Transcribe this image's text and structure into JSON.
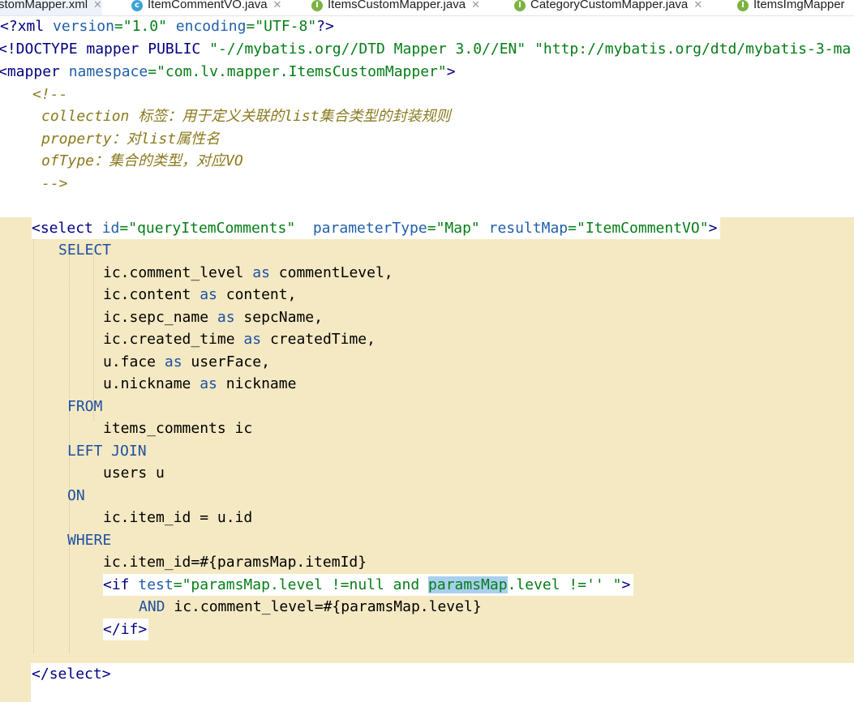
{
  "tabs": [
    {
      "label": "stomMapper.xml",
      "icon": "xml-file-icon",
      "active": true
    },
    {
      "label": "ItemCommentVO.java",
      "icon": "class-icon"
    },
    {
      "label": "ItemsCustomMapper.java",
      "icon": "interface-icon"
    },
    {
      "label": "CategoryCustomMapper.java",
      "icon": "interface-icon"
    },
    {
      "label": "ItemsImgMapper",
      "icon": "interface-icon"
    }
  ],
  "code": {
    "xml_decl": [
      "<?",
      "xml ",
      "version",
      "=\"1.0\" ",
      "encoding",
      "=\"UTF-8\"",
      "?>"
    ],
    "doctype": [
      "<!DOCTYPE ",
      "mapper ",
      "PUBLIC ",
      "\"-//mybatis.org//DTD Mapper 3.0//EN\" ",
      "\"http://mybatis.org/dtd/mybatis-3-ma"
    ],
    "mapper_open": [
      "<",
      "mapper ",
      "namespace",
      "=",
      "\"com.lv.mapper.ItemsCustomMapper\"",
      ">"
    ],
    "comment_open": "<!--",
    "comment_lines": [
      "collection 标签：用于定义关联的list集合类型的封装规则",
      "property：对list属性名",
      "ofType：集合的类型，对应VO"
    ],
    "comment_close": "-->",
    "select_open": {
      "tag": "select",
      "id_attr": "id",
      "id_val": "\"queryItemComments\"",
      "pt_attr": "parameterType",
      "pt_val": "\"Map\"",
      "rm_attr": "resultMap",
      "rm_val": "\"ItemCommentVO\""
    },
    "sql": {
      "select_kw": "SELECT",
      "columns": [
        {
          "expr": "ic.comment_level",
          "as": "as",
          "alias": "commentLevel,"
        },
        {
          "expr": "ic.content",
          "as": "as",
          "alias": "content,"
        },
        {
          "expr": "ic.sepc_name",
          "as": "as",
          "alias": "sepcName,"
        },
        {
          "expr": "ic.created_time",
          "as": "as",
          "alias": "createdTime,"
        },
        {
          "expr": "u.face",
          "as": "as",
          "alias": "userFace,"
        },
        {
          "expr": "u.nickname",
          "as": "as",
          "alias": "nickname"
        }
      ],
      "from_kw": "FROM",
      "from_table": "items_comments ic",
      "join_kw": "LEFT JOIN",
      "join_table": "users u",
      "on_kw": "ON",
      "on_cond": "ic.item_id = u.id",
      "where_kw": "WHERE",
      "where_cond": "ic.item_id=#{paramsMap.itemId}",
      "if_tag": "if",
      "if_attr": "test",
      "if_val_a": "\"paramsMap.level !=null and ",
      "if_val_sel": "paramsMap",
      "if_val_b": ".level !='' \"",
      "and_kw": "AND",
      "and_cond": "ic.comment_level=#{paramsMap.level}",
      "if_close": "if"
    },
    "select_close": "select"
  }
}
